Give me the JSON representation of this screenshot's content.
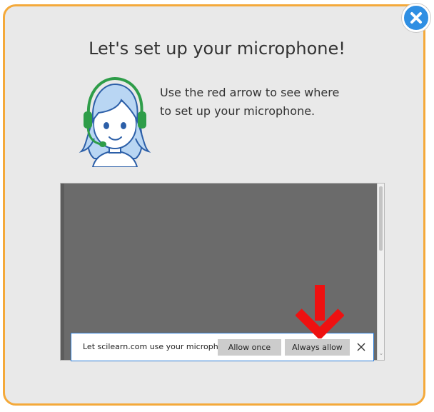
{
  "dialog": {
    "title": "Let's set up your microphone!",
    "instruction_line1": "Use the red arrow to see where",
    "instruction_line2": "to set up your microphone.",
    "close_icon": "close-icon",
    "avatar_icon": "headset-avatar-icon",
    "arrow_icon": "red-down-arrow-icon"
  },
  "browser_prompt": {
    "text": "Let scilearn.com use your microphone?",
    "allow_once_label": "Allow once",
    "always_allow_label": "Always allow",
    "dismiss_icon": "close-icon"
  },
  "colors": {
    "dialog_border": "#f4a93a",
    "dialog_background": "#e9e9e9",
    "close_button": "#2f8fe3",
    "arrow": "#ee1111",
    "prompt_border": "#2a7bd6",
    "browser_area": "#6b6b6b"
  }
}
